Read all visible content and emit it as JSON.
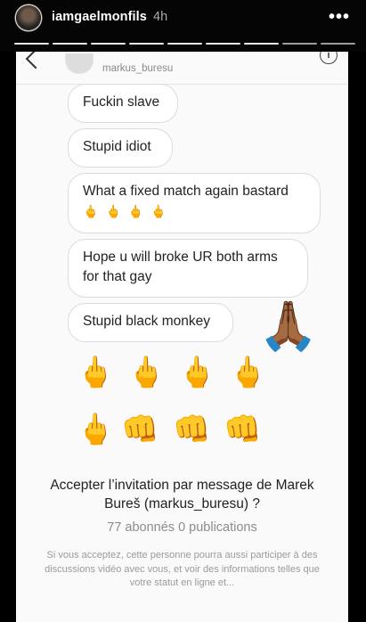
{
  "story": {
    "username": "iamgaelmonfils",
    "time": "4h",
    "more_label": "•••",
    "progress_segments": 9,
    "progress_completed": 7
  },
  "dm": {
    "contact_handle": "markus_buresu",
    "info_label": "i",
    "messages": [
      {
        "text": "Fuckin slave"
      },
      {
        "text": "Stupid idiot"
      },
      {
        "text": "What a fixed match again bastard",
        "emojis": [
          "🖕",
          "🖕",
          "🖕",
          "🖕"
        ]
      },
      {
        "text": "Hope u will broke UR both arms for that gay"
      },
      {
        "text": "Stupid black monkey"
      }
    ],
    "reaction_emoji": "🙏🏾",
    "emoji_rows": [
      [
        "🖕",
        "🖕",
        "🖕",
        "🖕"
      ],
      [
        "🖕",
        "👊",
        "👊",
        "👊"
      ]
    ]
  },
  "invite": {
    "title": "Accepter l’invitation par message de Marek Bureš (markus_buresu) ?",
    "stats": "77 abonnés 0 publications",
    "description": "Si vous acceptez, cette personne pourra aussi participer à des discussions vidéo avec vous, et voir des informations telles que votre statut en ligne et..."
  }
}
